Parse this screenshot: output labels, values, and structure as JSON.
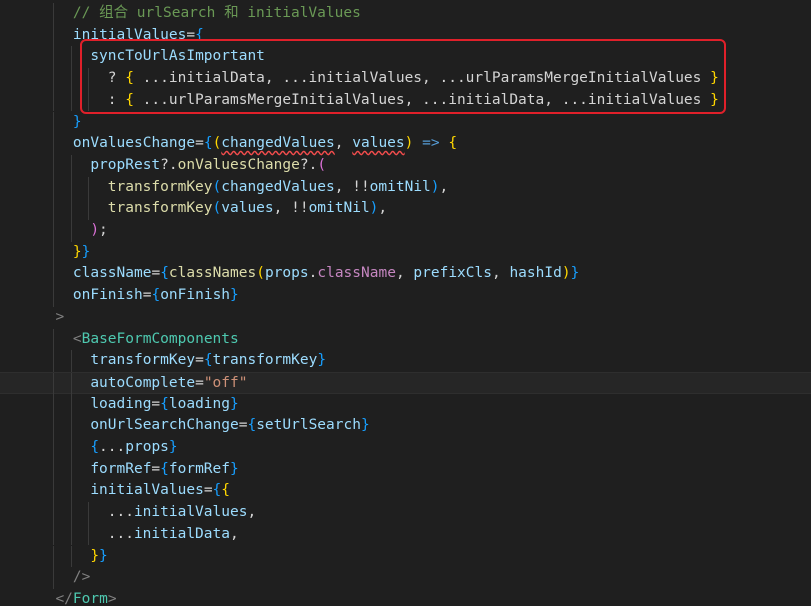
{
  "editor": {
    "highlight_color": "#e0202a",
    "lines": [
      {
        "indent": 4,
        "tokens": [
          {
            "c": "t-comment",
            "t": "// 组合 urlSearch 和 initialValues"
          }
        ]
      },
      {
        "indent": 4,
        "tokens": [
          {
            "c": "t-attr",
            "t": "initialValues"
          },
          {
            "c": "t-op",
            "t": "="
          },
          {
            "c": "t-brace2",
            "t": "{"
          }
        ]
      },
      {
        "indent": 6,
        "tokens": [
          {
            "c": "t-attr",
            "t": "syncToUrlAsImportant"
          }
        ]
      },
      {
        "indent": 8,
        "tokens": [
          {
            "c": "t-op",
            "t": "? "
          },
          {
            "c": "t-brace3",
            "t": "{"
          },
          {
            "c": "t-plain",
            "t": " ...initialData, ...initialValues, ...urlParamsMergeInitialValues "
          },
          {
            "c": "t-brace3",
            "t": "}"
          }
        ]
      },
      {
        "indent": 8,
        "tokens": [
          {
            "c": "t-op",
            "t": ": "
          },
          {
            "c": "t-brace3",
            "t": "{"
          },
          {
            "c": "t-plain",
            "t": " ...urlParamsMergeInitialValues, ...initialData, ...initialValues "
          },
          {
            "c": "t-brace3",
            "t": "}"
          }
        ]
      },
      {
        "indent": 4,
        "tokens": [
          {
            "c": "t-brace2",
            "t": "}"
          }
        ]
      },
      {
        "indent": 4,
        "tokens": [
          {
            "c": "t-attr",
            "t": "onValuesChange"
          },
          {
            "c": "t-op",
            "t": "="
          },
          {
            "c": "t-brace2",
            "t": "{"
          },
          {
            "c": "t-brace3",
            "t": "("
          },
          {
            "c": "t-attr squiggle",
            "t": "changedValues"
          },
          {
            "c": "t-op",
            "t": ", "
          },
          {
            "c": "t-attr squiggle",
            "t": "values"
          },
          {
            "c": "t-brace3",
            "t": ")"
          },
          {
            "c": "t-arrow",
            "t": " => "
          },
          {
            "c": "t-brace3",
            "t": "{"
          }
        ]
      },
      {
        "indent": 6,
        "tokens": [
          {
            "c": "t-attr",
            "t": "propRest"
          },
          {
            "c": "t-op",
            "t": "?."
          },
          {
            "c": "t-fn",
            "t": "onValuesChange"
          },
          {
            "c": "t-op",
            "t": "?."
          },
          {
            "c": "t-brace",
            "t": "("
          }
        ]
      },
      {
        "indent": 8,
        "tokens": [
          {
            "c": "t-fn",
            "t": "transformKey"
          },
          {
            "c": "t-brace2",
            "t": "("
          },
          {
            "c": "t-attr",
            "t": "changedValues"
          },
          {
            "c": "t-op",
            "t": ", !!"
          },
          {
            "c": "t-attr",
            "t": "omitNil"
          },
          {
            "c": "t-brace2",
            "t": ")"
          },
          {
            "c": "t-op",
            "t": ","
          }
        ]
      },
      {
        "indent": 8,
        "tokens": [
          {
            "c": "t-fn",
            "t": "transformKey"
          },
          {
            "c": "t-brace2",
            "t": "("
          },
          {
            "c": "t-attr",
            "t": "values"
          },
          {
            "c": "t-op",
            "t": ", !!"
          },
          {
            "c": "t-attr",
            "t": "omitNil"
          },
          {
            "c": "t-brace2",
            "t": ")"
          },
          {
            "c": "t-op",
            "t": ","
          }
        ]
      },
      {
        "indent": 6,
        "tokens": [
          {
            "c": "t-brace",
            "t": ")"
          },
          {
            "c": "t-op",
            "t": ";"
          }
        ]
      },
      {
        "indent": 4,
        "tokens": [
          {
            "c": "t-brace3",
            "t": "}"
          },
          {
            "c": "t-brace2",
            "t": "}"
          }
        ]
      },
      {
        "indent": 4,
        "tokens": [
          {
            "c": "t-attr",
            "t": "className"
          },
          {
            "c": "t-op",
            "t": "="
          },
          {
            "c": "t-brace2",
            "t": "{"
          },
          {
            "c": "t-fn",
            "t": "classNames"
          },
          {
            "c": "t-brace3",
            "t": "("
          },
          {
            "c": "t-attr",
            "t": "props"
          },
          {
            "c": "t-op",
            "t": "."
          },
          {
            "c": "t-prop",
            "t": "className"
          },
          {
            "c": "t-op",
            "t": ", "
          },
          {
            "c": "t-attr",
            "t": "prefixCls"
          },
          {
            "c": "t-op",
            "t": ", "
          },
          {
            "c": "t-attr",
            "t": "hashId"
          },
          {
            "c": "t-brace3",
            "t": ")"
          },
          {
            "c": "t-brace2",
            "t": "}"
          }
        ]
      },
      {
        "indent": 4,
        "tokens": [
          {
            "c": "t-attr",
            "t": "onFinish"
          },
          {
            "c": "t-op",
            "t": "="
          },
          {
            "c": "t-brace2",
            "t": "{"
          },
          {
            "c": "t-attr",
            "t": "onFinish"
          },
          {
            "c": "t-brace2",
            "t": "}"
          }
        ]
      },
      {
        "indent": 2,
        "tokens": [
          {
            "c": "t-tagpunct",
            "t": ">"
          }
        ]
      },
      {
        "indent": 4,
        "tokens": [
          {
            "c": "t-tagpunct",
            "t": "<"
          },
          {
            "c": "t-tag",
            "t": "BaseFormComponents"
          }
        ]
      },
      {
        "indent": 6,
        "tokens": [
          {
            "c": "t-attr",
            "t": "transformKey"
          },
          {
            "c": "t-op",
            "t": "="
          },
          {
            "c": "t-brace2",
            "t": "{"
          },
          {
            "c": "t-attr",
            "t": "transformKey"
          },
          {
            "c": "t-brace2",
            "t": "}"
          }
        ]
      },
      {
        "indent": 6,
        "current": true,
        "tokens": [
          {
            "c": "t-attr",
            "t": "autoComplete"
          },
          {
            "c": "t-op",
            "t": "="
          },
          {
            "c": "t-string",
            "t": "\"off\""
          }
        ]
      },
      {
        "indent": 6,
        "tokens": [
          {
            "c": "t-attr",
            "t": "loading"
          },
          {
            "c": "t-op",
            "t": "="
          },
          {
            "c": "t-brace2",
            "t": "{"
          },
          {
            "c": "t-attr",
            "t": "loading"
          },
          {
            "c": "t-brace2",
            "t": "}"
          }
        ]
      },
      {
        "indent": 6,
        "tokens": [
          {
            "c": "t-attr",
            "t": "onUrlSearchChange"
          },
          {
            "c": "t-op",
            "t": "="
          },
          {
            "c": "t-brace2",
            "t": "{"
          },
          {
            "c": "t-attr",
            "t": "setUrlSearch"
          },
          {
            "c": "t-brace2",
            "t": "}"
          }
        ]
      },
      {
        "indent": 6,
        "tokens": [
          {
            "c": "t-brace2",
            "t": "{"
          },
          {
            "c": "t-op",
            "t": "..."
          },
          {
            "c": "t-attr",
            "t": "props"
          },
          {
            "c": "t-brace2",
            "t": "}"
          }
        ]
      },
      {
        "indent": 6,
        "tokens": [
          {
            "c": "t-attr",
            "t": "formRef"
          },
          {
            "c": "t-op",
            "t": "="
          },
          {
            "c": "t-brace2",
            "t": "{"
          },
          {
            "c": "t-attr",
            "t": "formRef"
          },
          {
            "c": "t-brace2",
            "t": "}"
          }
        ]
      },
      {
        "indent": 6,
        "tokens": [
          {
            "c": "t-attr",
            "t": "initialValues"
          },
          {
            "c": "t-op",
            "t": "="
          },
          {
            "c": "t-brace2",
            "t": "{"
          },
          {
            "c": "t-brace3",
            "t": "{"
          }
        ]
      },
      {
        "indent": 8,
        "tokens": [
          {
            "c": "t-op",
            "t": "..."
          },
          {
            "c": "t-attr",
            "t": "initialValues"
          },
          {
            "c": "t-op",
            "t": ","
          }
        ]
      },
      {
        "indent": 8,
        "tokens": [
          {
            "c": "t-op",
            "t": "..."
          },
          {
            "c": "t-attr",
            "t": "initialData"
          },
          {
            "c": "t-op",
            "t": ","
          }
        ]
      },
      {
        "indent": 6,
        "tokens": [
          {
            "c": "t-brace3",
            "t": "}"
          },
          {
            "c": "t-brace2",
            "t": "}"
          }
        ]
      },
      {
        "indent": 4,
        "tokens": [
          {
            "c": "t-tagpunct",
            "t": "/>"
          }
        ]
      },
      {
        "indent": 2,
        "tokens": [
          {
            "c": "t-tagpunct",
            "t": "</"
          },
          {
            "c": "t-tag",
            "t": "Form"
          },
          {
            "c": "t-tagpunct",
            "t": ">"
          }
        ]
      }
    ]
  }
}
